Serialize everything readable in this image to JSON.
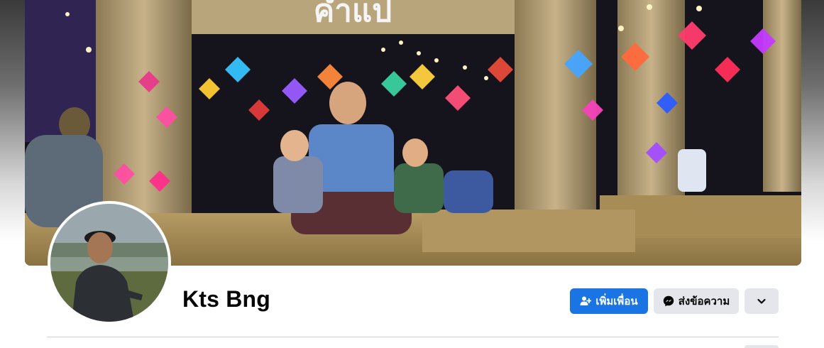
{
  "profile": {
    "name": "Kts Bng"
  },
  "actions": {
    "add_friend_label": "เพิ่มเพื่อน",
    "message_label": "ส่งข้อความ",
    "more_icon": "chevron-down-icon"
  },
  "cover": {
    "sign_text": "คำแป"
  },
  "colors": {
    "primary_button": "#1b74e4",
    "secondary_button": "#e4e6eb",
    "text": "#050505",
    "divider": "#ced0d4"
  }
}
